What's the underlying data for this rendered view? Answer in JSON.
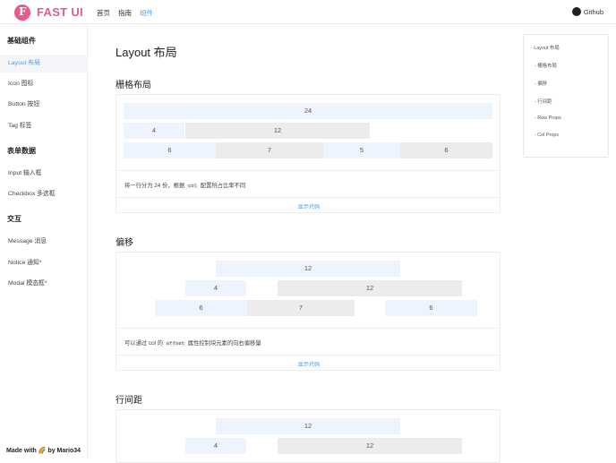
{
  "header": {
    "brand": "FAST UI",
    "logo_letter": "F",
    "nav": [
      "首页",
      "指南",
      "组件"
    ],
    "github": "Github"
  },
  "sidebar": {
    "groups": [
      {
        "title": "基础组件",
        "items": [
          "Layout 布局",
          "Icon 图标",
          "Button 按钮",
          "Tag 标签"
        ]
      },
      {
        "title": "表单数据",
        "items": [
          "Input 输入框",
          "Checkbox 多选框"
        ]
      },
      {
        "title": "交互",
        "items": [
          "Message 消息",
          "Notice 通知*",
          "Modal 模态框*"
        ]
      }
    ],
    "footer": "Made with 🌈 by Mario34"
  },
  "toc": {
    "items": [
      "- Layout 布局",
      "- 栅格布局",
      "- 偏移",
      "- 行间距",
      "- Row Props",
      "- Col Props"
    ]
  },
  "main": {
    "title": "Layout 布局",
    "sections": [
      {
        "heading": "栅格布局",
        "rows": [
          [
            "24"
          ],
          [
            "4",
            "12"
          ],
          [
            "6",
            "7",
            "5",
            "6"
          ]
        ],
        "desc_before": "将一行分为 24 份，根据 ",
        "desc_code": "col",
        "desc_after": " 配置所占比率不同",
        "show_code": "显示代码"
      },
      {
        "heading": "偏移",
        "rows": [
          [
            "12"
          ],
          [
            "4",
            "12"
          ],
          [
            "6",
            "7",
            "6"
          ]
        ],
        "desc_before": "可以通过 col 的 ",
        "desc_code": "offset",
        "desc_after": " 属性控制块元素的向右偏移量",
        "show_code": "显示代码"
      },
      {
        "heading": "行间距",
        "rows": [
          [
            "12"
          ],
          [
            "4",
            "12"
          ]
        ]
      }
    ]
  },
  "colors": {
    "accent": "#4a9eee",
    "brand": "#e85a88",
    "cell_blue": "#eef4fd",
    "cell_gray": "#ececec"
  }
}
